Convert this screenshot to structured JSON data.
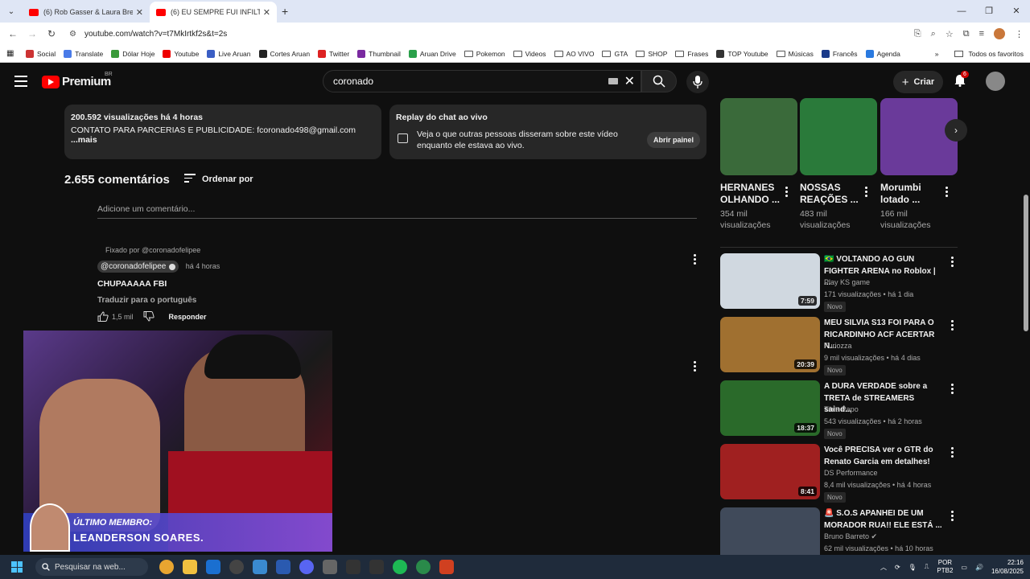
{
  "browser": {
    "tabs": [
      {
        "title": "(6) Rob Gasser & Laura Brehm -",
        "active": false
      },
      {
        "title": "(6) EU SEMPRE FUI INFILTRADO",
        "active": true
      }
    ],
    "url": "youtube.com/watch?v=t7MkIrtkf2s&t=2s",
    "bookmarks": [
      "Social",
      "Translate",
      "Dólar Hoje",
      "Youtube",
      "Live Aruan",
      "Cortes Aruan",
      "Twitter",
      "Thumbnail",
      "Aruan Drive",
      "Pokemon",
      "Videos",
      "AO VIVO",
      "GTA",
      "SHOP",
      "Frases",
      "TOP Youtube",
      "Músicas",
      "Francês",
      "Agenda"
    ],
    "all_bookmarks": "Todos os favoritos"
  },
  "header": {
    "logo": "Premium",
    "region": "BR",
    "search_value": "coronado",
    "create_label": "Criar",
    "notif_count": "6"
  },
  "description": {
    "views": "200.592 visualizações  há 4 horas",
    "text": "CONTATO PARA PARCERIAS E PUBLICIDADE: fcoronado498@gmail.com",
    "more": "...mais"
  },
  "replay": {
    "title": "Replay do chat ao vivo",
    "body": "Veja o que outras pessoas disseram sobre este vídeo enquanto ele estava ao vivo.",
    "button": "Abrir painel"
  },
  "comments": {
    "count": "2.655 comentários",
    "sort": "Ordenar por",
    "add_placeholder": "Adicione um comentário...",
    "pinned_by": "Fixado por @coronadofelipee",
    "handle": "@coronadofelipee",
    "time": "há 4 horas",
    "text": "CHUPAAAAA FBI",
    "translate": "Traduzir para o português",
    "likes": "1,5 mil",
    "reply": "Responder"
  },
  "player": {
    "caption_top": "ÚLTIMO MEMBRO:",
    "caption_name": "LEANDERSON SOARES."
  },
  "shorts": [
    {
      "title": "HERNANES OLHANDO ...",
      "views": "354 mil visualizações",
      "color": "#3a6a3a"
    },
    {
      "title": "NOSSAS REAÇÕES ...",
      "views": "483 mil visualizações",
      "color": "#2a7a3a"
    },
    {
      "title": "Morumbi lotado ...",
      "views": "166 mil visualizações",
      "color": "#6a3a9a"
    }
  ],
  "videos": [
    {
      "title": "🇧🇷 VOLTANDO AO GUN FIGHTER ARENA no Roblox | ...",
      "channel": "Play KS game",
      "meta": "171 visualizações • há 1 dia",
      "badge": "Novo",
      "duration": "7:59",
      "color": "#d0d8e0"
    },
    {
      "title": "MEU SILVIA S13 FOI PARA O RICARDINHO ACF ACERTAR N...",
      "channel": "Furiozza",
      "meta": "9 mil visualizações • há 4 dias",
      "badge": "Novo",
      "duration": "20:39",
      "color": "#a07030"
    },
    {
      "title": "A DURA VERDADE sobre a TRETA de  STREAMERS saind...",
      "channel": "Tibia Papo",
      "meta": "543 visualizações • há 2 horas",
      "badge": "Novo",
      "duration": "18:37",
      "color": "#2a6a2a"
    },
    {
      "title": "Você PRECISA ver o GTR do Renato Garcia em detalhes!",
      "channel": "DS Performance",
      "meta": "8,4 mil visualizações • há 4 horas",
      "badge": "Novo",
      "duration": "8:41",
      "color": "#a02020"
    },
    {
      "title": "🚨 S.O.S APANHEI DE UM MORADOR RUA!! ELE ESTÁ ...",
      "channel": "Bruno Barreto",
      "meta": "62 mil visualizações • há 10 horas",
      "badge": "",
      "duration": "",
      "color": "#404a5a"
    }
  ],
  "taskbar": {
    "search": "Pesquisar na web...",
    "lang1": "POR",
    "lang2": "PTB2",
    "time": "22:16",
    "date": "16/08/2025"
  }
}
